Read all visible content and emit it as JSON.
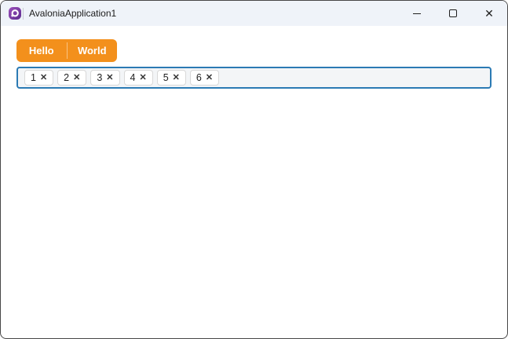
{
  "window": {
    "title": "AvaloniaApplication1"
  },
  "icons": {
    "window_close": "✕",
    "chip_remove": "✕"
  },
  "tabs": [
    {
      "label": "Hello"
    },
    {
      "label": "World"
    }
  ],
  "chip_input": {
    "chips": [
      {
        "label": "1"
      },
      {
        "label": "2"
      },
      {
        "label": "3"
      },
      {
        "label": "4"
      },
      {
        "label": "5"
      },
      {
        "label": "6"
      }
    ]
  },
  "colors": {
    "tab_background": "#F3901C",
    "tab_text": "#FFFFFF",
    "input_focus_border": "#2B7AB4",
    "input_background": "#F3F5F7",
    "chip_border": "#D8D8D8",
    "titlebar_background": "#EFF3F9",
    "window_border": "#474747",
    "logo_purple": "#7E3A9D"
  }
}
